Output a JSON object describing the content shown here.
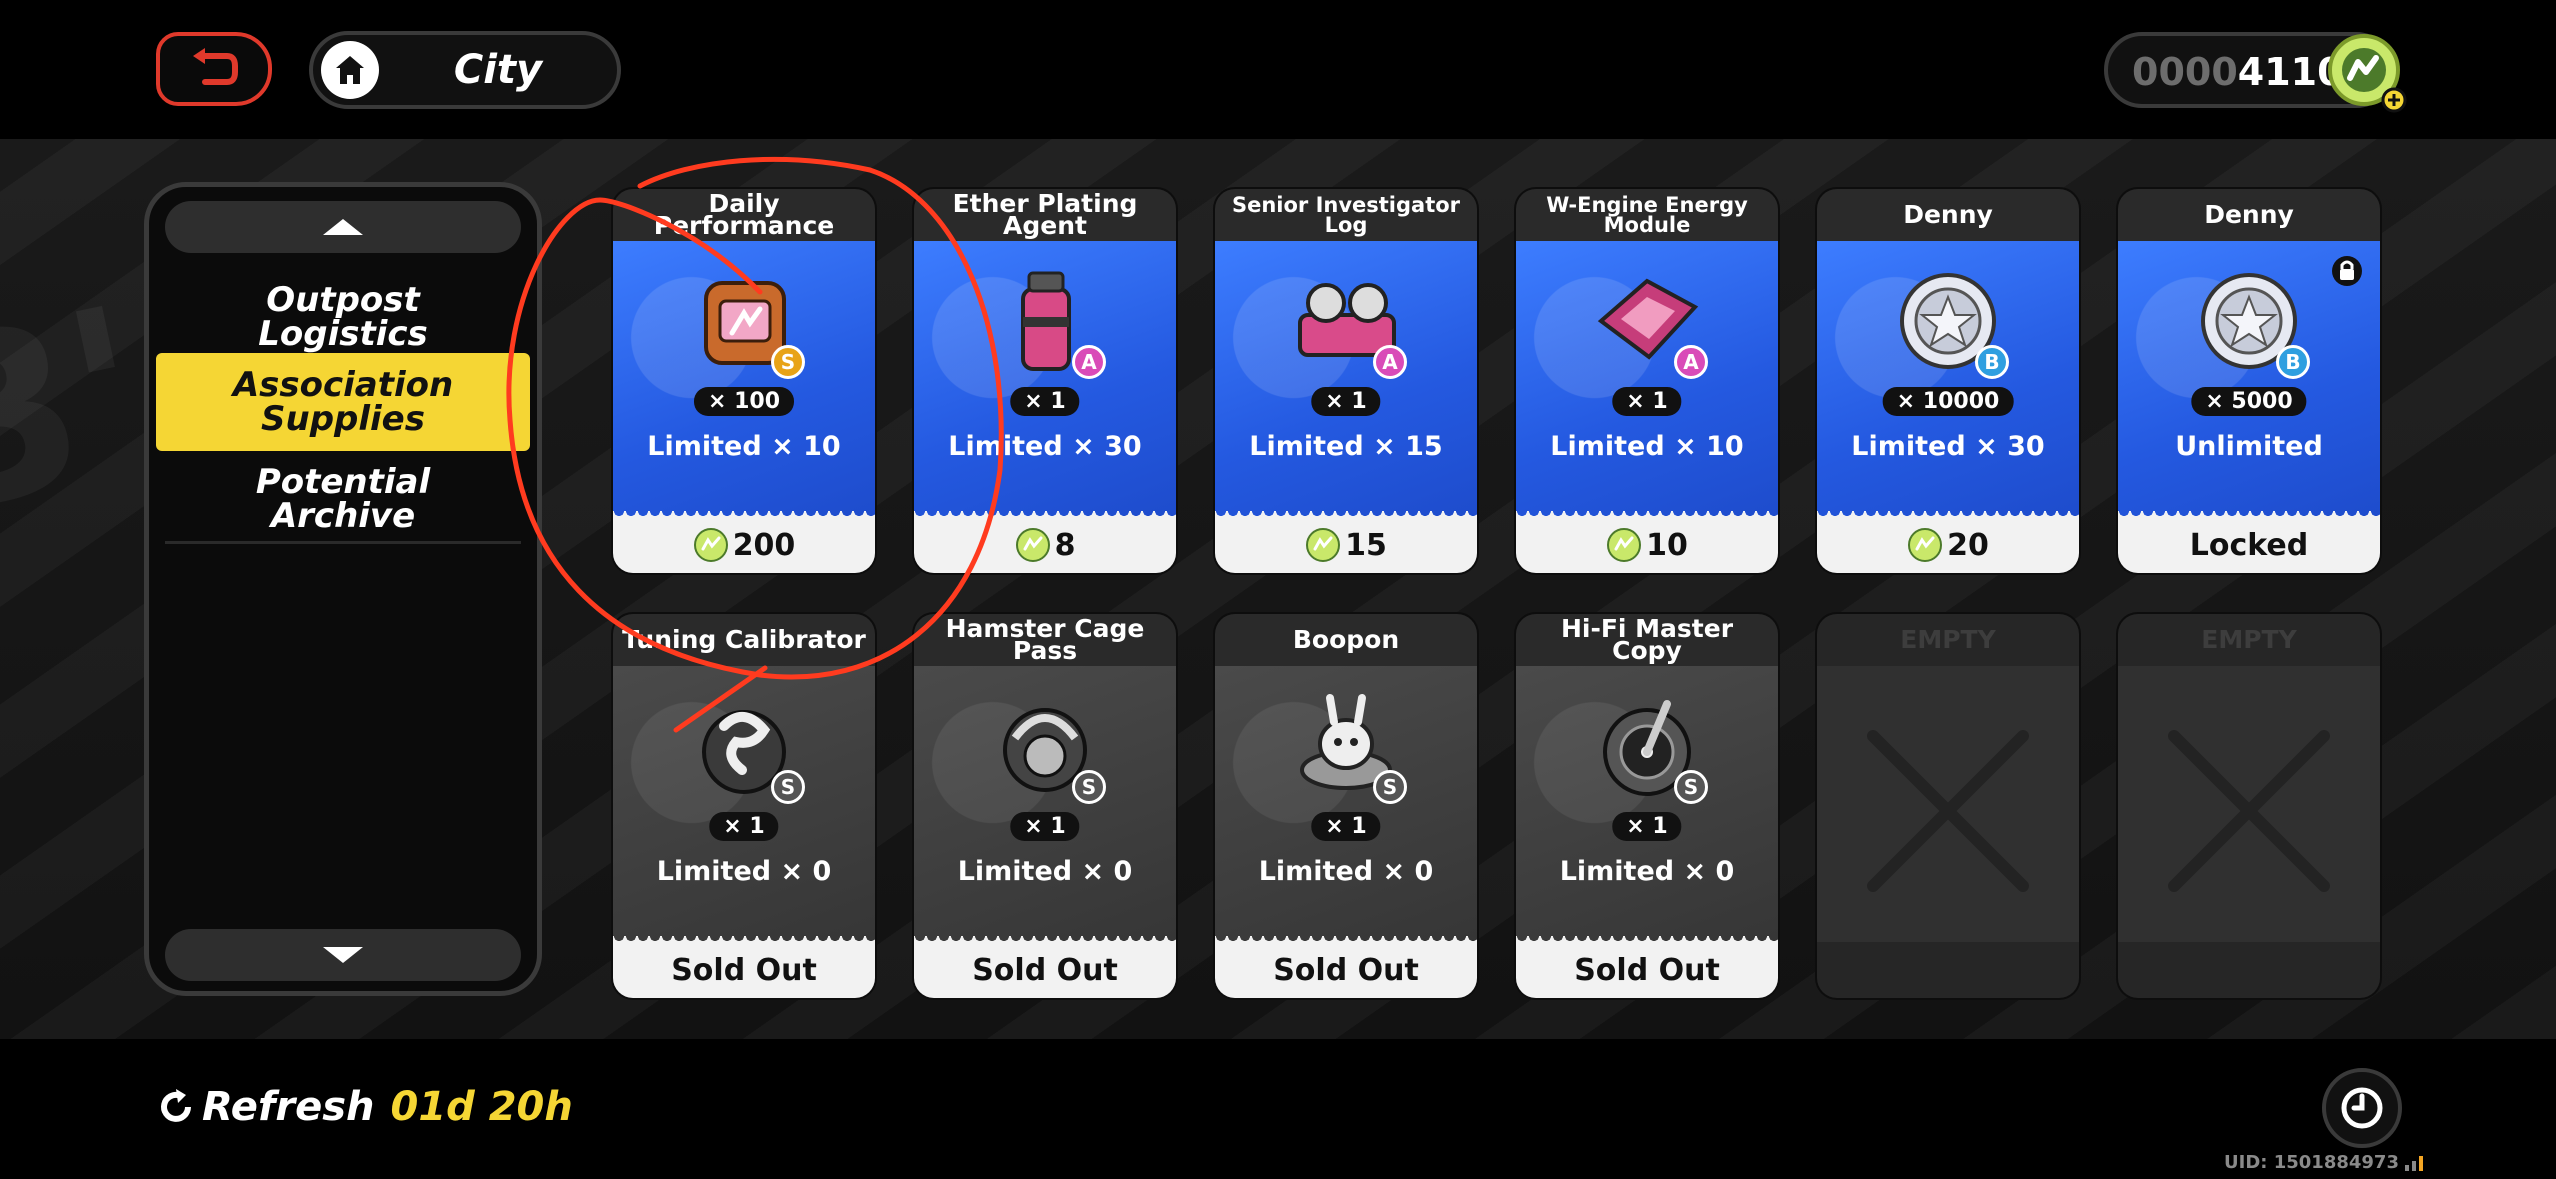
{
  "header": {
    "breadcrumb": "City",
    "currency": {
      "dim_digits": "0000",
      "value_digits": "4110"
    }
  },
  "sidebar": {
    "items": [
      {
        "label": "Outpost\nLogistics",
        "active": false
      },
      {
        "label": "Association\nSupplies",
        "active": true
      },
      {
        "label": "Potential\nArchive",
        "active": false
      }
    ]
  },
  "shop": {
    "items": [
      {
        "title": "Daily Performance",
        "qty": "× 100",
        "limit": "Limited × 10",
        "price": "200",
        "rank": "S",
        "icon": "charge-battery-icon",
        "footer_type": "price"
      },
      {
        "title": "Ether Plating Agent",
        "qty": "× 1",
        "limit": "Limited × 30",
        "price": "8",
        "rank": "A",
        "icon": "plating-agent-canister-icon",
        "footer_type": "price"
      },
      {
        "title": "Senior Investigator Log",
        "qty": "× 1",
        "limit": "Limited × 15",
        "price": "15",
        "rank": "A",
        "icon": "tape-recorder-icon",
        "footer_type": "price"
      },
      {
        "title": "W-Engine Energy Module",
        "qty": "× 1",
        "limit": "Limited × 10",
        "price": "10",
        "rank": "A",
        "icon": "energy-module-icon",
        "footer_type": "price"
      },
      {
        "title": "Denny",
        "qty": "× 10000",
        "limit": "Limited × 30",
        "price": "20",
        "rank": "B",
        "icon": "denny-coin-icon",
        "footer_type": "price"
      },
      {
        "title": "Denny",
        "qty": "× 5000",
        "limit": "Unlimited",
        "footer": "Locked",
        "rank": "B",
        "icon": "denny-coin-icon",
        "footer_type": "text",
        "locked": true
      },
      {
        "title": "Tuning Calibrator",
        "qty": "× 1",
        "limit": "Limited × 0",
        "footer": "Sold Out",
        "rank": "S",
        "icon": "tuning-calibrator-icon",
        "footer_type": "text"
      },
      {
        "title": "Hamster Cage Pass",
        "qty": "× 1",
        "limit": "Limited × 0",
        "footer": "Sold Out",
        "rank": "S",
        "icon": "hamster-cage-pass-icon",
        "footer_type": "text"
      },
      {
        "title": "Boopon",
        "qty": "× 1",
        "limit": "Limited × 0",
        "footer": "Sold Out",
        "rank": "S",
        "icon": "boopon-icon",
        "footer_type": "text"
      },
      {
        "title": "Hi-Fi Master Copy",
        "qty": "× 1",
        "limit": "Limited × 0",
        "footer": "Sold Out",
        "rank": "S",
        "icon": "hifi-master-copy-icon",
        "footer_type": "text"
      },
      {
        "title": "EMPTY",
        "empty": true
      },
      {
        "title": "EMPTY",
        "empty": true
      }
    ]
  },
  "footer": {
    "refresh_label": "Refresh",
    "refresh_time": "01d 20h",
    "uid": "UID: 1501884973"
  },
  "colors": {
    "accent_yellow": "#f5d634",
    "card_blue": "#2459e0",
    "annotation_red": "#ff3b1f"
  }
}
